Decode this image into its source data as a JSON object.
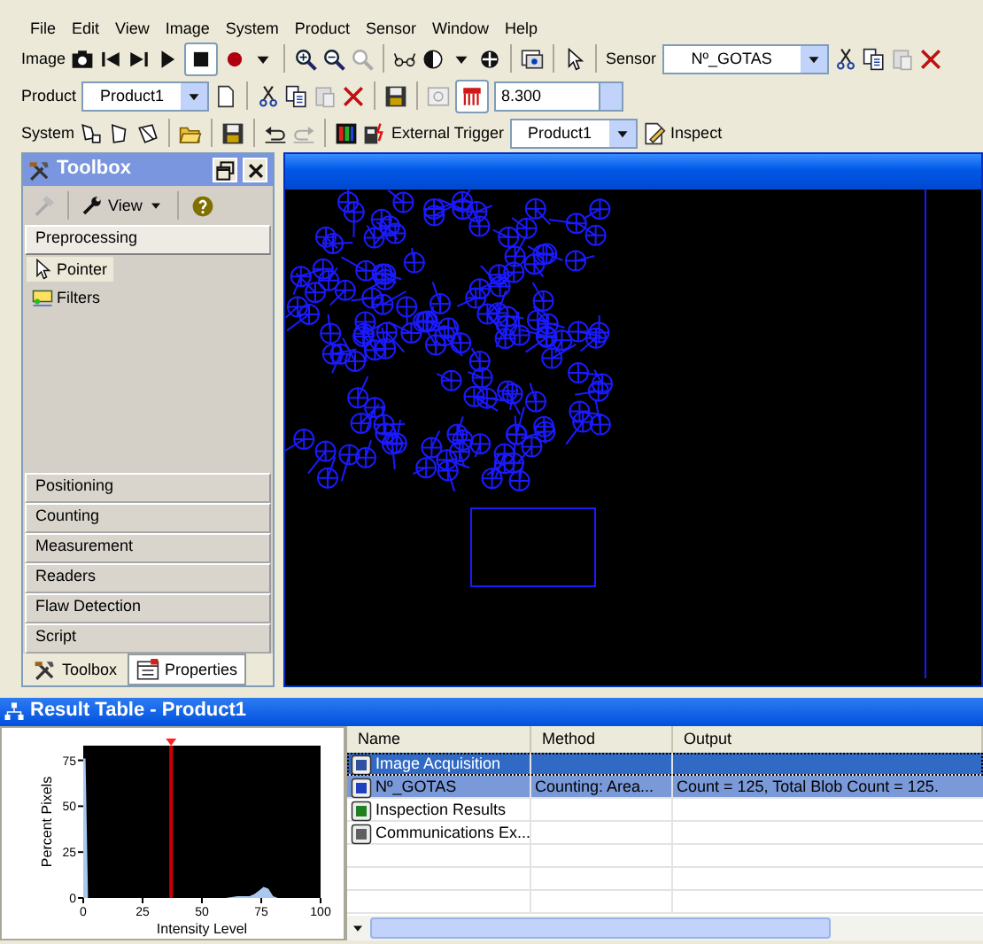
{
  "menu": [
    "File",
    "Edit",
    "View",
    "Image",
    "System",
    "Product",
    "Sensor",
    "Window",
    "Help"
  ],
  "toolbars": [
    {
      "label": "Image",
      "sensor_label": "Sensor",
      "sensor_dropdown": "Nº_GOTAS"
    },
    {
      "label": "Product",
      "product_dropdown": "Product1",
      "value_field": "8.300"
    },
    {
      "label": "System",
      "trigger_button": "External Trigger",
      "product_dropdown": "Product1",
      "inspect_button": "Inspect"
    }
  ],
  "toolbox": {
    "title": "Toolbox",
    "view_button": "View",
    "categories": [
      {
        "label": "Preprocessing",
        "expanded": true,
        "items": [
          {
            "label": "Pointer",
            "selected": true
          },
          {
            "label": "Filters",
            "selected": false
          }
        ]
      },
      {
        "label": "Positioning",
        "expanded": false
      },
      {
        "label": "Counting",
        "expanded": false
      },
      {
        "label": "Measurement",
        "expanded": false
      },
      {
        "label": "Readers",
        "expanded": false
      },
      {
        "label": "Flaw Detection",
        "expanded": false
      },
      {
        "label": "Script",
        "expanded": false
      }
    ],
    "tabs": [
      {
        "label": "Toolbox",
        "selected": true
      },
      {
        "label": "Properties",
        "selected": false
      }
    ]
  },
  "result_table": {
    "title": "Result Table - Product1",
    "histogram": {
      "chart_data": {
        "type": "area",
        "xlabel": "Intensity Level",
        "ylabel": "Percent Pixels",
        "x": [
          0,
          1,
          2,
          60,
          65,
          70,
          72,
          74,
          76,
          78,
          80,
          82,
          100
        ],
        "series": [
          {
            "color": "#a8c8f0",
            "values": [
              76,
              76,
              0,
              0,
              1,
              1,
              2,
              4,
              6,
              5,
              1,
              0,
              0
            ]
          }
        ],
        "xlim": [
          0,
          100
        ],
        "ylim": [
          0,
          83
        ],
        "xticks": [
          0,
          25,
          50,
          75,
          100
        ],
        "yticks": [
          0,
          25,
          50,
          75
        ],
        "ref_lines": [
          {
            "axis": "x",
            "value": 37
          }
        ]
      }
    },
    "columns": [
      "Name",
      "Method",
      "Output"
    ],
    "rows": [
      {
        "kind": "acquisition",
        "name": "Image Acquisition",
        "selected": true,
        "focused": true
      },
      {
        "kind": "sensor",
        "name": "Nº_GOTAS",
        "method": "Counting: Area...",
        "output": "Count = 125, Total Blob Count = 125.",
        "selected": true,
        "focused": false
      },
      {
        "kind": "results",
        "name": "Inspection Results",
        "selected": false,
        "focused": false
      },
      {
        "kind": "communications",
        "name": "Communications Ex...",
        "selected": false,
        "focused": false
      }
    ]
  }
}
